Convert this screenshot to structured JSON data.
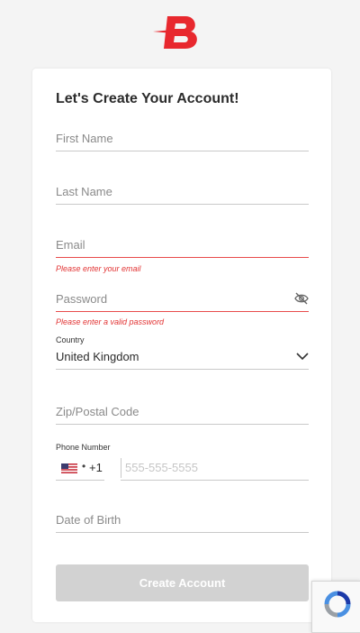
{
  "brand": {
    "logo_name": "brand-logo",
    "accent": "#e8282e"
  },
  "form": {
    "title": "Let's Create Your Account!",
    "first_name_placeholder": "First Name",
    "last_name_placeholder": "Last Name",
    "email_placeholder": "Email",
    "email_error": "Please enter your email",
    "password_placeholder": "Password",
    "password_error": "Please enter a valid password",
    "country_label": "Country",
    "country_value": "United Kingdom",
    "zip_placeholder": "Zip/Postal Code",
    "phone_label": "Phone Number",
    "phone_country_code": "+1",
    "phone_placeholder": "555-555-5555",
    "dob_placeholder": "Date of Birth",
    "submit_label": "Create Account"
  },
  "colors": {
    "error": "#e23434",
    "button_disabled": "#d2d2d2"
  },
  "icons": [
    "eye-off-icon",
    "chevron-down-icon",
    "us-flag-icon",
    "recaptcha-icon"
  ]
}
